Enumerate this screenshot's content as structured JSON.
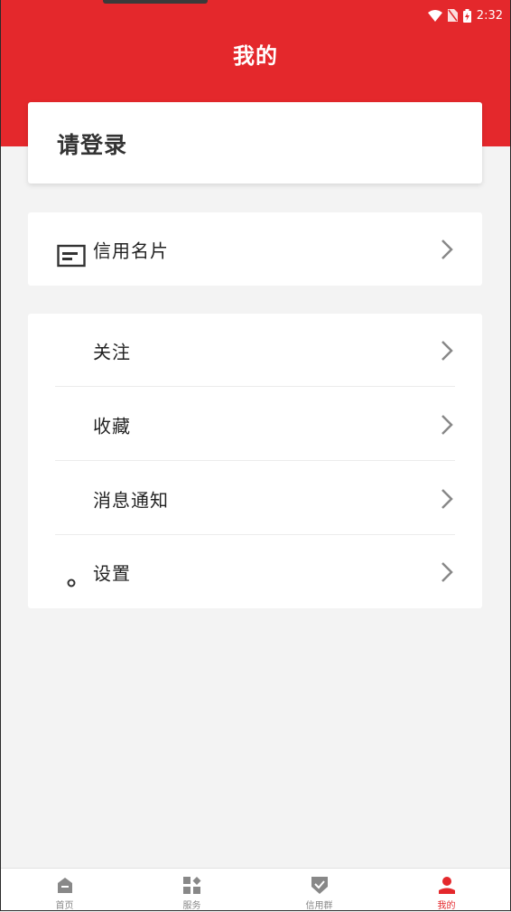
{
  "status_bar": {
    "time": "2:32",
    "icons": [
      "wifi-icon",
      "no-sim-icon",
      "battery-charging-icon"
    ]
  },
  "header": {
    "title": "我的"
  },
  "login": {
    "label": "请登录"
  },
  "menu_group_1": [
    {
      "label": "信用名片",
      "icon": "business-card-icon"
    }
  ],
  "menu_group_2": [
    {
      "label": "关注"
    },
    {
      "label": "收藏"
    },
    {
      "label": "消息通知"
    },
    {
      "label": "设置",
      "icon": "settings-icon"
    }
  ],
  "tabbar": {
    "items": [
      {
        "label": "首页",
        "icon": "home-icon"
      },
      {
        "label": "服务",
        "icon": "services-icon"
      },
      {
        "label": "信用群",
        "icon": "shield-check-icon"
      },
      {
        "label": "我的",
        "icon": "person-icon",
        "active": true
      }
    ]
  },
  "colors": {
    "brand_red": "#e4282c",
    "icon_gray": "#888888",
    "background": "#f3f3f3"
  }
}
